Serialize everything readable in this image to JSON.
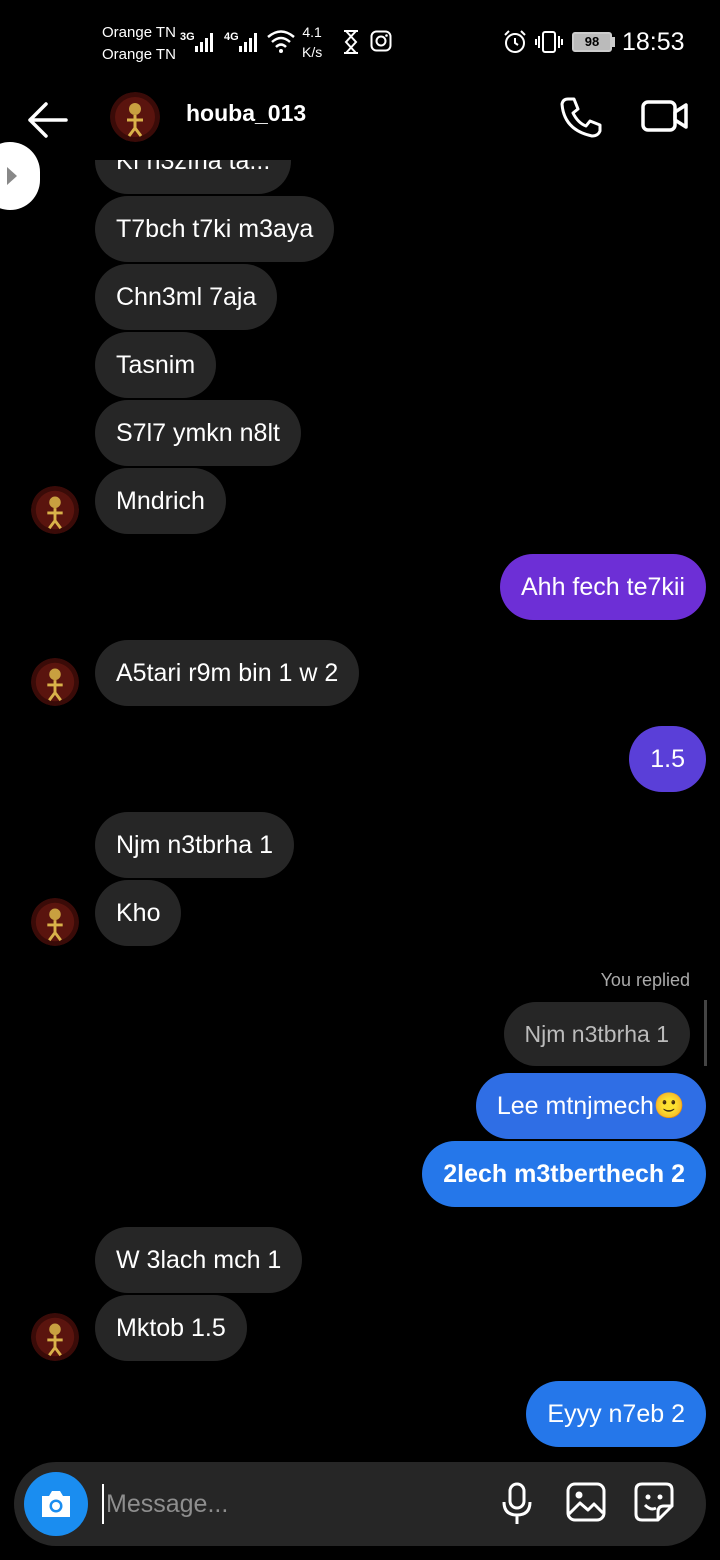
{
  "status_bar": {
    "carrier1": "Orange TN",
    "carrier2": "Orange TN",
    "net1": "3G",
    "net2": "4G",
    "speed_value": "4.1",
    "speed_unit": "K/s",
    "battery": "98",
    "time": "18:53"
  },
  "header": {
    "username": "houba_013"
  },
  "messages": [
    {
      "text": "Kı n3zına ta...",
      "side": "in"
    },
    {
      "text": "T7bch t7ki m3aya",
      "side": "in"
    },
    {
      "text": "Chn3ml 7aja",
      "side": "in"
    },
    {
      "text": "Tasnim",
      "side": "in"
    },
    {
      "text": "S7l7 ymkn n8lt",
      "side": "in"
    },
    {
      "text": "Mndrich",
      "side": "in"
    },
    {
      "text": "Ahh fech te7kii",
      "side": "out"
    },
    {
      "text": "A5tari r9m bin 1 w 2",
      "side": "in"
    },
    {
      "text": "1.5",
      "side": "out"
    },
    {
      "text": "Njm n3tbrha 1",
      "side": "in"
    },
    {
      "text": "Kho",
      "side": "in"
    },
    {
      "text": "Lee mtnjmech🙂",
      "side": "out"
    },
    {
      "text": "2lech m3tberthech 2",
      "side": "out"
    },
    {
      "text": "W 3lach mch 1",
      "side": "in"
    },
    {
      "text": "Mktob 1.5",
      "side": "in"
    },
    {
      "text": "Eyyy n7eb 2",
      "side": "out"
    }
  ],
  "reply": {
    "label": "You replied",
    "quoted": "Njm n3tbrha 1"
  },
  "composer": {
    "placeholder": "Message..."
  },
  "colors": {
    "incoming_bubble": "#262626",
    "outgoing_purple": "#6d2fd6",
    "outgoing_blue": "#2f6ee5",
    "camera_button": "#1a8df0"
  }
}
